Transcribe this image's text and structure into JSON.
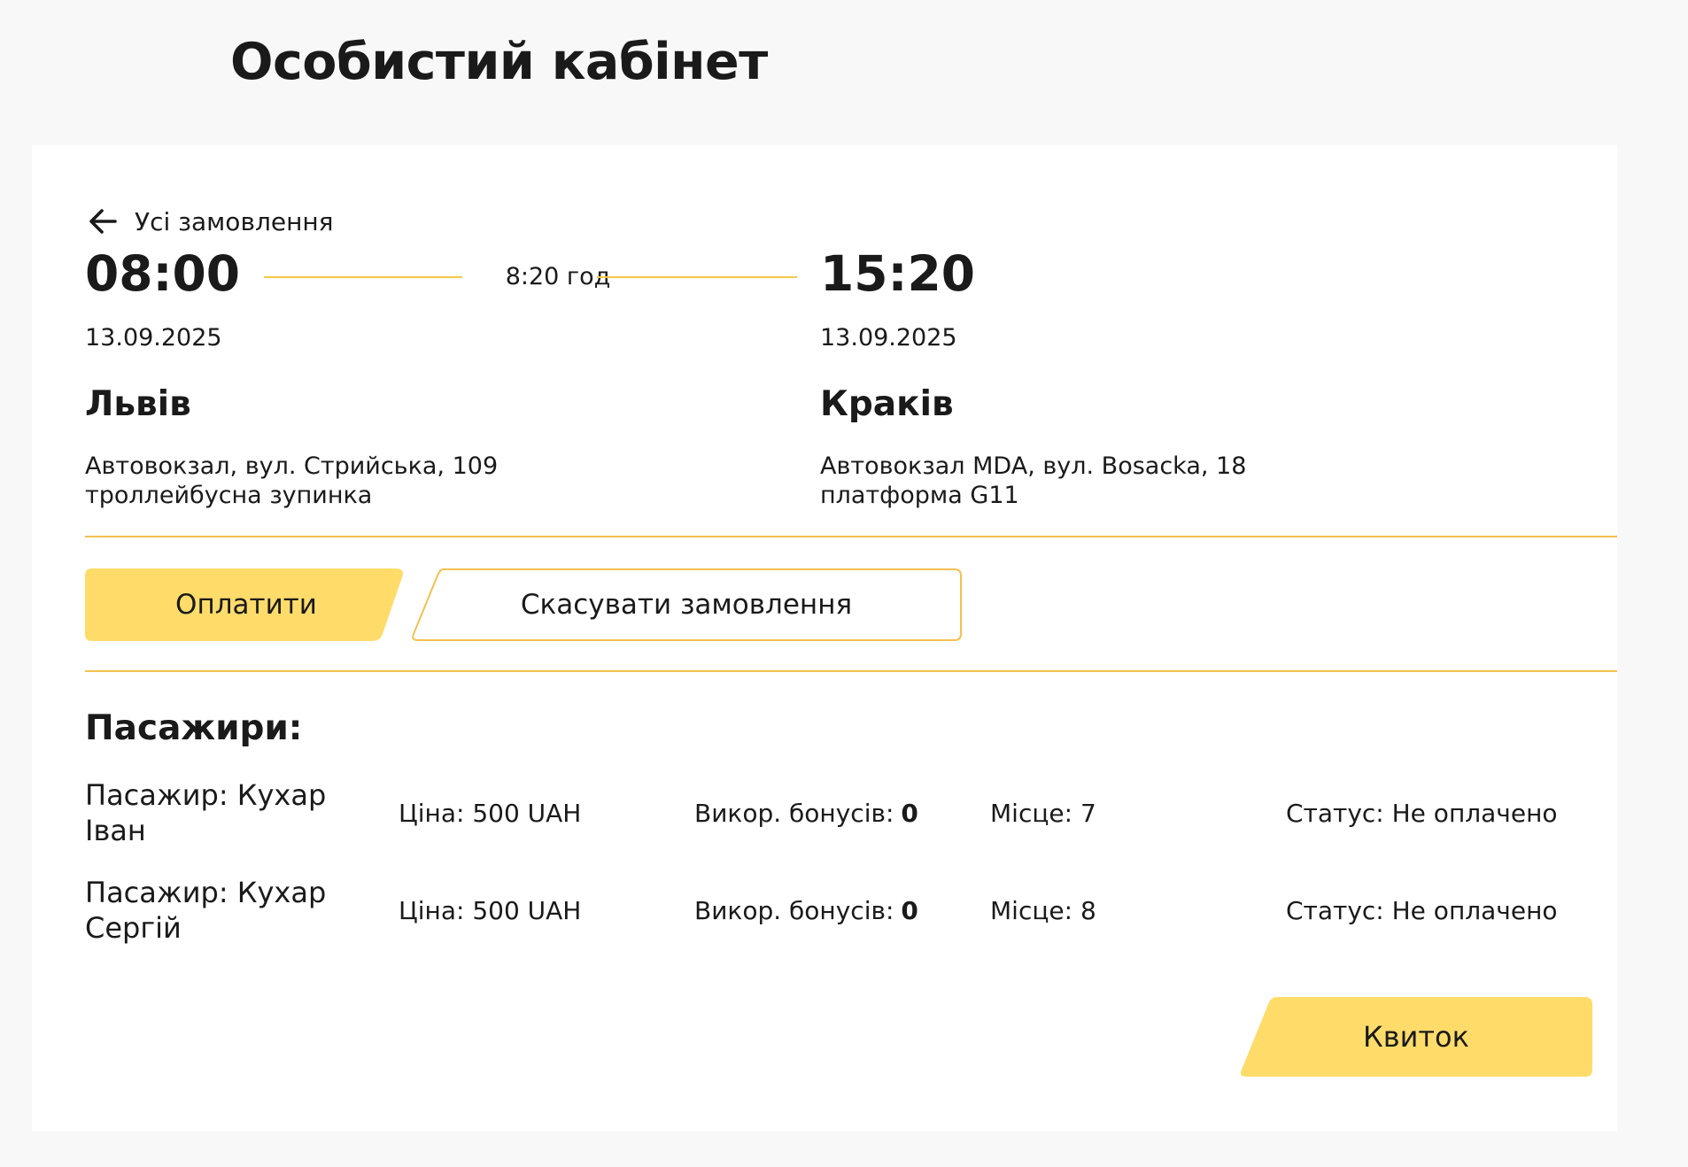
{
  "page": {
    "title": "Особистий кабінет"
  },
  "order": {
    "back_label": "Усі замовлення",
    "duration": "8:20 год",
    "departure": {
      "time": "08:00",
      "date": "13.09.2025",
      "city": "Львів",
      "address_line1": "Автовокзал, вул. Стрийська, 109",
      "address_line2": "троллейбусна зупинка"
    },
    "arrival": {
      "time": "15:20",
      "date": "13.09.2025",
      "city": "Краків",
      "address_line1": "Автовокзал MDA, вул. Bosacka, 18",
      "address_line2": "платформа G11"
    },
    "actions": {
      "pay_label": "Оплатити",
      "cancel_label": "Скасувати замовлення"
    }
  },
  "passengers": {
    "heading": "Пасажири:",
    "rows": [
      {
        "name": "Пасажир: Кухар Іван",
        "price": "Ціна: 500 UAH",
        "bonus_label": "Викор. бонусів:",
        "bonus_value": "0",
        "seat": "Місце: 7",
        "status": "Статус: Не оплачено"
      },
      {
        "name": "Пасажир: Кухар Сергій",
        "price": "Ціна: 500 UAH",
        "bonus_label": "Викор. бонусів:",
        "bonus_value": "0",
        "seat": "Місце: 8",
        "status": "Статус: Не оплачено"
      }
    ],
    "ticket_label": "Квиток"
  },
  "icons": {
    "back": "arrow-left-icon"
  },
  "colors": {
    "accent": "#ffdc6a",
    "accent_border": "#f2c14e",
    "page_background": "#f8f8f8",
    "card_background": "#ffffff",
    "text": "#1a1a1a"
  }
}
